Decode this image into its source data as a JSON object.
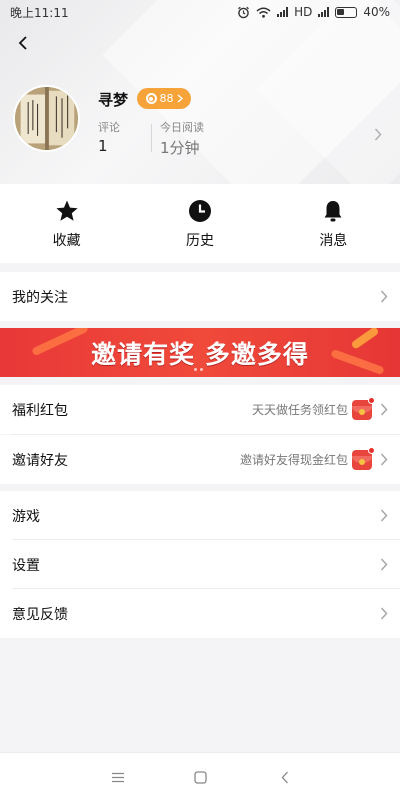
{
  "status_bar": {
    "time": "晚上11:11",
    "network": "HD",
    "battery": "40%"
  },
  "profile": {
    "username": "寻梦",
    "level": "88",
    "stats": [
      {
        "label": "评论",
        "value": "1"
      },
      {
        "label": "今日阅读",
        "value": "1分钟"
      }
    ]
  },
  "quick_actions": [
    {
      "label": "收藏",
      "icon": "star-icon"
    },
    {
      "label": "历史",
      "icon": "clock-icon"
    },
    {
      "label": "消息",
      "icon": "bell-icon"
    }
  ],
  "menu": {
    "follow": {
      "label": "我的关注"
    },
    "welfare": {
      "label": "福利红包",
      "hint": "天天做任务领红包",
      "icon": "red-envelope-icon"
    },
    "invite": {
      "label": "邀请好友",
      "hint": "邀请好友得现金红包",
      "icon": "red-envelope-icon"
    },
    "games": {
      "label": "游戏"
    },
    "settings": {
      "label": "设置"
    },
    "feedback": {
      "label": "意见反馈"
    }
  },
  "banner": {
    "text": "邀请有奖 多邀多得"
  },
  "colors": {
    "accent_orange": "#f6a33a",
    "banner_red": "#e83838",
    "redpack_red": "#e8453c"
  }
}
